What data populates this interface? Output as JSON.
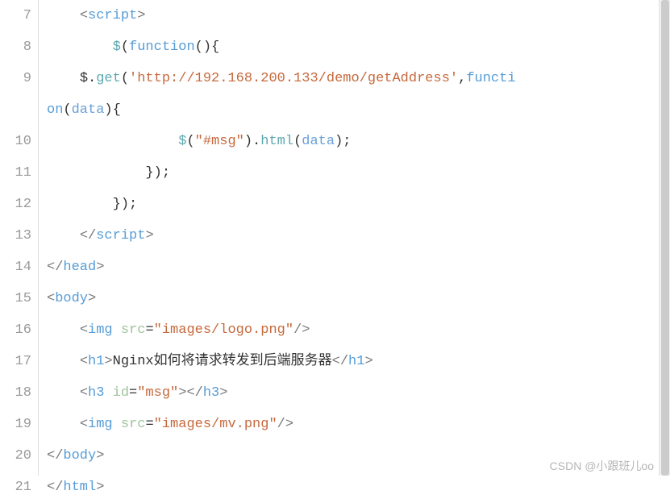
{
  "gutter": {
    "start": 7,
    "end": 21,
    "wrappedAfter": 9
  },
  "code": {
    "lines": [
      {
        "n": 7,
        "indent": "    ",
        "tokens": [
          [
            "punc",
            "<"
          ],
          [
            "tag",
            "script"
          ],
          [
            "punc",
            ">"
          ]
        ]
      },
      {
        "n": 8,
        "indent": "        ",
        "tokens": [
          [
            "fn",
            "$"
          ],
          [
            "br",
            "("
          ],
          [
            "kw",
            "function"
          ],
          [
            "br",
            "(){"
          ]
        ]
      },
      {
        "n": 9,
        "indent": "    ",
        "wrap": true,
        "tokens": [
          [
            "txt",
            "$."
          ],
          [
            "fn",
            "get"
          ],
          [
            "br",
            "("
          ],
          [
            "str",
            "'http://192.168.200.133/demo/getAddress'"
          ],
          [
            "txt",
            ","
          ],
          [
            "kw",
            "functi"
          ],
          [
            "br",
            ""
          ],
          [
            "kw",
            "on"
          ],
          [
            "br",
            "("
          ],
          [
            "var",
            "data"
          ],
          [
            "br",
            "){"
          ]
        ]
      },
      {
        "n": 10,
        "indent": "                ",
        "tokens": [
          [
            "fn",
            "$"
          ],
          [
            "br",
            "("
          ],
          [
            "str",
            "\"#msg\""
          ],
          [
            "br",
            ")."
          ],
          [
            "fn",
            "html"
          ],
          [
            "br",
            "("
          ],
          [
            "var",
            "data"
          ],
          [
            "br",
            ");"
          ]
        ]
      },
      {
        "n": 11,
        "indent": "            ",
        "tokens": [
          [
            "br",
            "});"
          ]
        ]
      },
      {
        "n": 12,
        "indent": "        ",
        "tokens": [
          [
            "br",
            "});"
          ]
        ]
      },
      {
        "n": 13,
        "indent": "    ",
        "tokens": [
          [
            "punc",
            "</"
          ],
          [
            "tag",
            "script"
          ],
          [
            "punc",
            ">"
          ]
        ]
      },
      {
        "n": 14,
        "indent": "",
        "tokens": [
          [
            "punc",
            "</"
          ],
          [
            "tag",
            "head"
          ],
          [
            "punc",
            ">"
          ]
        ]
      },
      {
        "n": 15,
        "indent": "",
        "tokens": [
          [
            "punc",
            "<"
          ],
          [
            "tag",
            "body"
          ],
          [
            "punc",
            ">"
          ]
        ]
      },
      {
        "n": 16,
        "indent": "    ",
        "tokens": [
          [
            "punc",
            "<"
          ],
          [
            "tag",
            "img"
          ],
          [
            "txt",
            " "
          ],
          [
            "attr",
            "src"
          ],
          [
            "txt",
            "="
          ],
          [
            "str",
            "\"images/logo.png\""
          ],
          [
            "punc",
            "/>"
          ]
        ]
      },
      {
        "n": 17,
        "indent": "    ",
        "tokens": [
          [
            "punc",
            "<"
          ],
          [
            "tag",
            "h1"
          ],
          [
            "punc",
            ">"
          ],
          [
            "txt",
            "Nginx如何将请求转发到后端服务器"
          ],
          [
            "punc",
            "</"
          ],
          [
            "tag",
            "h1"
          ],
          [
            "punc",
            ">"
          ]
        ]
      },
      {
        "n": 18,
        "indent": "    ",
        "tokens": [
          [
            "punc",
            "<"
          ],
          [
            "tag",
            "h3"
          ],
          [
            "txt",
            " "
          ],
          [
            "attr",
            "id"
          ],
          [
            "txt",
            "="
          ],
          [
            "str",
            "\"msg\""
          ],
          [
            "punc",
            "></"
          ],
          [
            "tag",
            "h3"
          ],
          [
            "punc",
            ">"
          ]
        ]
      },
      {
        "n": 19,
        "indent": "    ",
        "tokens": [
          [
            "punc",
            "<"
          ],
          [
            "tag",
            "img"
          ],
          [
            "txt",
            " "
          ],
          [
            "attr",
            "src"
          ],
          [
            "txt",
            "="
          ],
          [
            "str",
            "\"images/mv.png\""
          ],
          [
            "punc",
            "/>"
          ]
        ]
      },
      {
        "n": 20,
        "indent": "",
        "tokens": [
          [
            "punc",
            "</"
          ],
          [
            "tag",
            "body"
          ],
          [
            "punc",
            ">"
          ]
        ]
      },
      {
        "n": 21,
        "indent": "",
        "tokens": [
          [
            "punc",
            "</"
          ],
          [
            "tag",
            "html"
          ],
          [
            "punc",
            ">"
          ]
        ]
      }
    ]
  },
  "watermark": "CSDN @小跟班儿oo"
}
